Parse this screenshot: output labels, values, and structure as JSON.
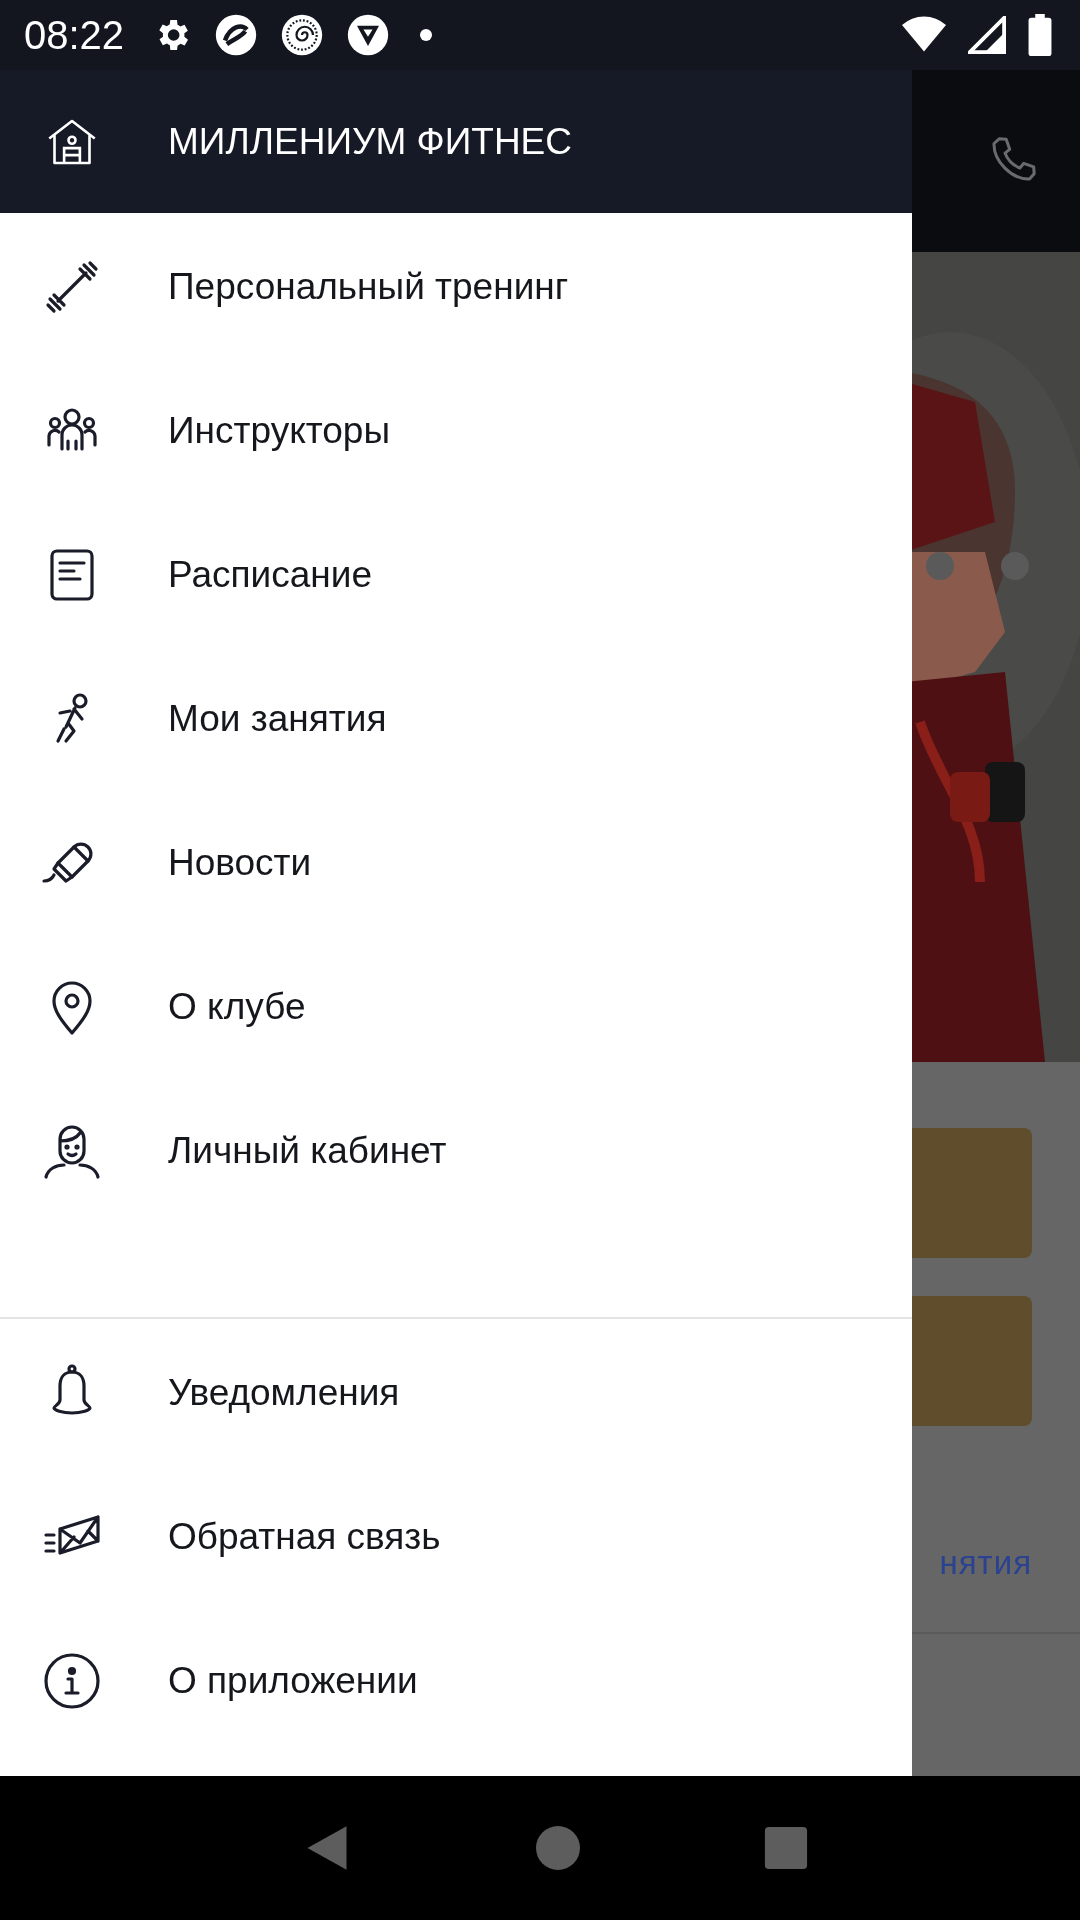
{
  "status_bar": {
    "time": "08:22"
  },
  "drawer": {
    "title": "МИЛЛЕНИУМ ФИТНЕС",
    "items": [
      {
        "label": "Персональный тренинг"
      },
      {
        "label": "Инструкторы"
      },
      {
        "label": "Расписание"
      },
      {
        "label": "Мои занятия"
      },
      {
        "label": "Новости"
      },
      {
        "label": "О клубе"
      },
      {
        "label": "Личный кабинет"
      }
    ],
    "bottom_items": [
      {
        "label": "Уведомления"
      },
      {
        "label": "Обратная связь"
      },
      {
        "label": "О приложении"
      }
    ]
  },
  "background": {
    "link_text": "нятия"
  }
}
